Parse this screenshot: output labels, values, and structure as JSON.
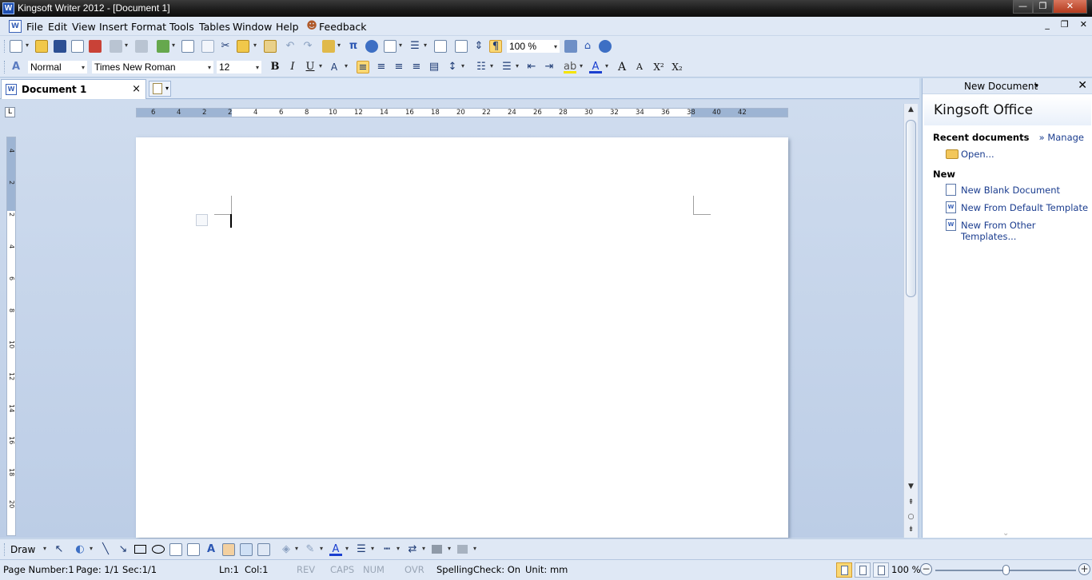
{
  "window": {
    "title": "Kingsoft Writer 2012 - [Document 1]",
    "app_icon_glyph": "W",
    "minimize_glyph": "—",
    "maximize_glyph": "❐",
    "close_glyph": "✕"
  },
  "menubar": {
    "doc_icon_glyph": "W",
    "items": [
      "File",
      "Edit",
      "View",
      "Insert",
      "Format",
      "Tools",
      "Tables",
      "Window",
      "Help",
      "Feedback"
    ],
    "right_controls": [
      "_",
      "❐",
      "✕"
    ]
  },
  "toolbar": {
    "zoom_value": "100 %",
    "style_value": "Normal",
    "font_value": "Times New Roman",
    "size_value": "12",
    "bold_label": "B",
    "italic_label": "I",
    "underline_label": "U",
    "grow_font_label": "A",
    "shrink_font_label": "A",
    "superscript_label": "X²",
    "subscript_label": "X₂",
    "icons": [
      "new-doc",
      "open",
      "save",
      "email",
      "pdf",
      "print",
      "print-preview",
      "insert-object",
      "copy-format-brush",
      "copy",
      "cut",
      "paste",
      "format-painter",
      "undo",
      "redo",
      "insert-table",
      "pi",
      "globe",
      "table-grid",
      "columns",
      "chart",
      "paragraph-marks",
      "show-hide",
      "zoom",
      "home",
      "help"
    ]
  },
  "tabs": {
    "document_tab": "Document 1",
    "close_glyph": "×"
  },
  "ruler": {
    "horizontal_ticks": [
      "6",
      "4",
      "2",
      "2",
      "4",
      "6",
      "8",
      "10",
      "12",
      "14",
      "16",
      "18",
      "20",
      "22",
      "24",
      "26",
      "28",
      "30",
      "32",
      "34",
      "36",
      "38",
      "40",
      "42"
    ],
    "vertical_ticks": [
      "4",
      "2",
      "2",
      "4",
      "6",
      "8",
      "10",
      "12",
      "14",
      "16",
      "18",
      "20"
    ],
    "corner_glyph": "L"
  },
  "taskpane": {
    "title": "New Document",
    "brand": "Kingsoft Office",
    "recent_label": "Recent documents",
    "manage_label": "» Manage",
    "open_label": "Open...",
    "new_label": "New",
    "new_blank": "New Blank Document",
    "new_default": "New From Default Template",
    "new_other": "New From Other Templates..."
  },
  "drawbar": {
    "draw_label": "Draw"
  },
  "statusbar": {
    "page_number": "Page Number:1",
    "page": "Page: 1/1",
    "section": "Sec:1/1",
    "line": "Ln:1",
    "column": "Col:1",
    "rev": "REV",
    "caps": "CAPS",
    "num": "NUM",
    "ovr": "OVR",
    "spelling": "SpellingCheck: On",
    "unit": "Unit: mm",
    "zoom": "100 %",
    "zoom_minus": "−",
    "zoom_plus": "+"
  },
  "colors": {
    "accent": "#3d6fc4",
    "toolbar_bg": "#dfe8f5",
    "workspace_bg": "#c3d3e9",
    "link": "#1b3d8f",
    "active_button": "#fbd873"
  }
}
